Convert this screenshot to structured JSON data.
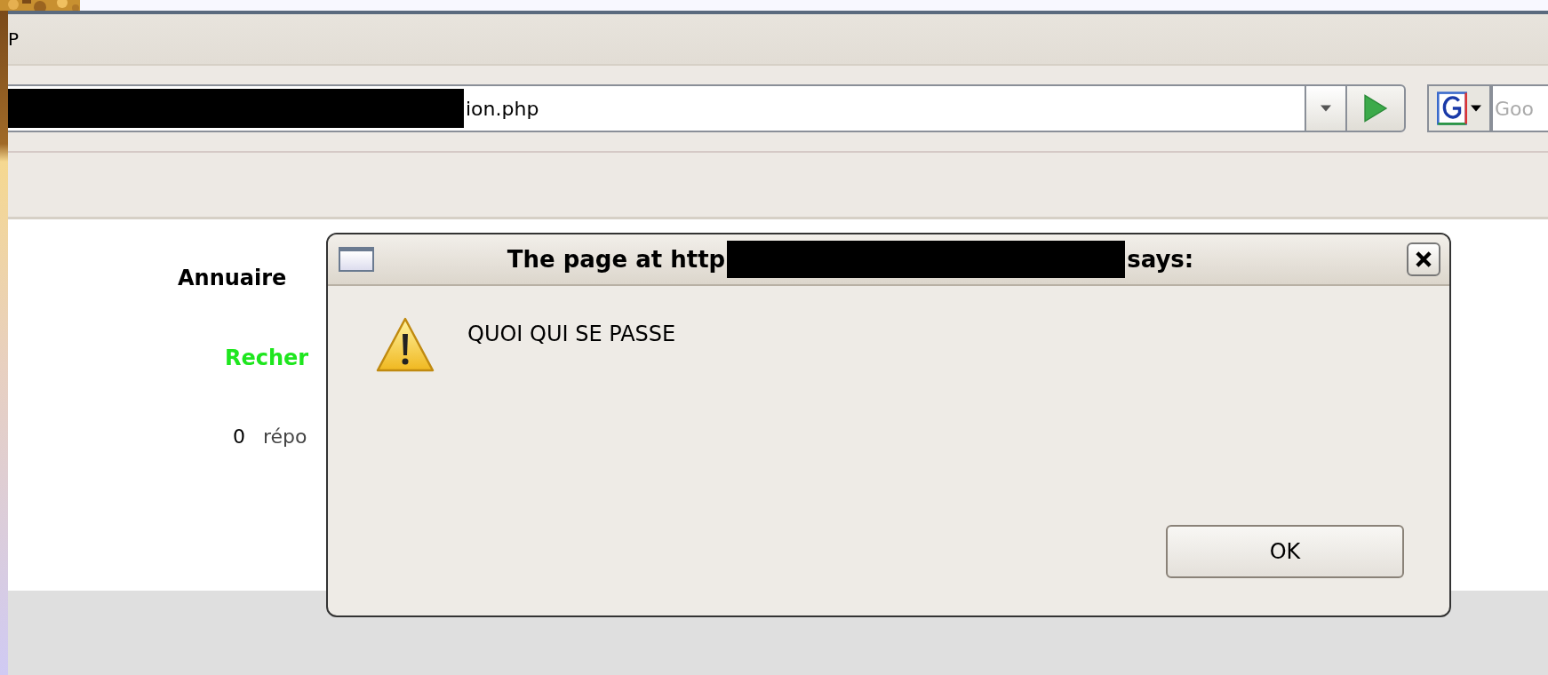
{
  "browser": {
    "menu_bar": {
      "items": [
        "P"
      ]
    },
    "address_bar": {
      "value": "ion.php"
    },
    "search": {
      "placeholder": "Goo"
    },
    "page": {
      "heading": "Annuaire",
      "subheading": "Recher",
      "result_count": "0",
      "result_label": "répo"
    }
  },
  "dialog": {
    "title_start": "The page at http",
    "title_end": "says:",
    "message": "QUOI QUI SE PASSE",
    "buttons": [
      "OK"
    ]
  }
}
